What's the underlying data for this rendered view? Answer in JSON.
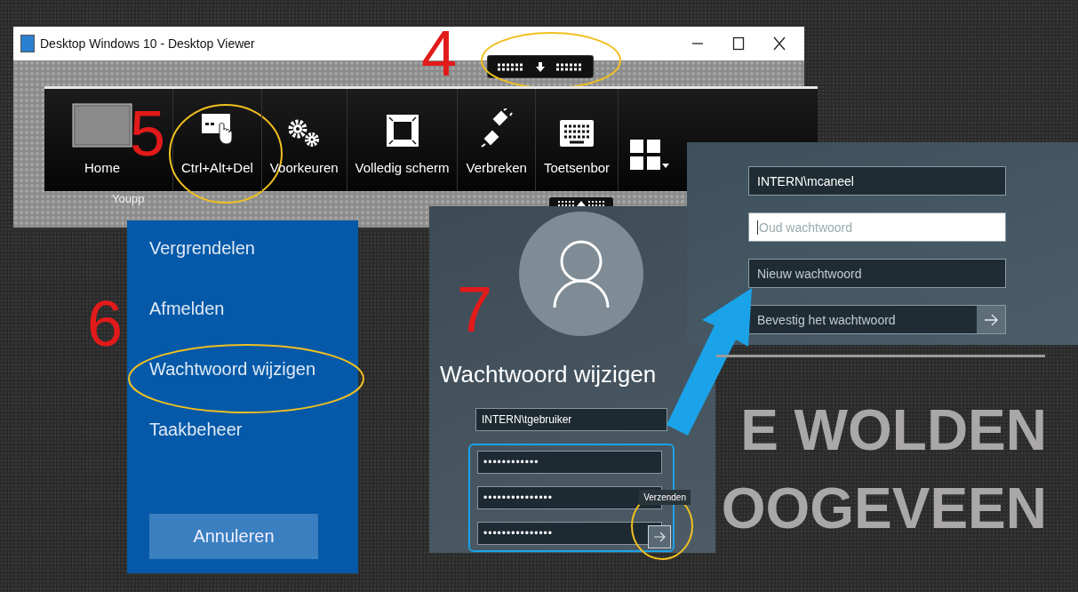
{
  "viewer_window": {
    "title": "Desktop Windows 10 - Desktop Viewer",
    "desktop_icon_label": "Youpp"
  },
  "connection_bar": {
    "highlighted": true
  },
  "toolbar": {
    "items": [
      {
        "kind": "home",
        "label": "Home",
        "highlighted": false
      },
      {
        "kind": "ctrl-alt-del",
        "label": "Ctrl+Alt+Del",
        "highlighted": true
      },
      {
        "kind": "preferences",
        "label": "Voorkeuren",
        "highlighted": false
      },
      {
        "kind": "fullscreen",
        "label": "Volledig scherm",
        "highlighted": false
      },
      {
        "kind": "disconnect",
        "label": "Verbreken",
        "highlighted": false
      },
      {
        "kind": "keyboard",
        "label": "Toetsenbor",
        "highlighted": false
      },
      {
        "kind": "apps",
        "highlighted": false
      }
    ]
  },
  "step_markers": [
    {
      "label": "4"
    },
    {
      "label": "5"
    },
    {
      "label": "6"
    },
    {
      "label": "7"
    }
  ],
  "security_menu": {
    "items": [
      {
        "label": "Vergrendelen",
        "highlighted": false
      },
      {
        "label": "Afmelden",
        "highlighted": false
      },
      {
        "label": "Wachtwoord wijzigen",
        "highlighted": true
      },
      {
        "label": "Taakbeheer",
        "highlighted": false
      }
    ],
    "cancel_button": "Annuleren"
  },
  "change_password_dialog": {
    "title": "Wachtwoord wijzigen",
    "username": "INTERN\\tgebruiker",
    "password_fields": [
      {
        "value": "••••••••••••"
      },
      {
        "value": "•••••••••••••••"
      },
      {
        "value": "•••••••••••••••"
      }
    ],
    "submit_tooltip": "Verzenden",
    "submit_highlighted": true
  },
  "change_password_form": {
    "username": "INTERN\\mcaneel",
    "fields": [
      {
        "kind": "plain",
        "placeholder": "Oud wachtwoord",
        "focused": true
      },
      {
        "kind": "plain",
        "placeholder": "Nieuw wachtwoord",
        "focused": false
      },
      {
        "kind": "with_submit",
        "placeholder": "Bevestig het wachtwoord",
        "focused": false
      }
    ]
  },
  "banner": {
    "lines": [
      "E WOLDEN",
      "OOGEVEEN"
    ]
  }
}
